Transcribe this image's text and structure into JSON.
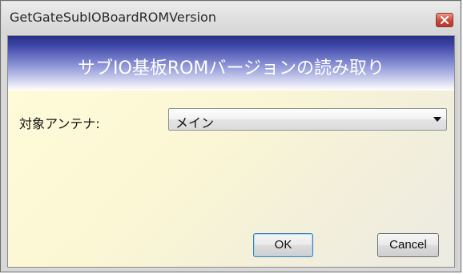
{
  "window": {
    "title": "GetGateSubIOBoardROMVersion",
    "close_icon": "close-icon"
  },
  "banner": {
    "title": "サブIO基板ROMバージョンの読み取り"
  },
  "form": {
    "antenna_label": "対象アンテナ:",
    "antenna_value": "メイン"
  },
  "buttons": {
    "ok": "OK",
    "cancel": "Cancel"
  },
  "colors": {
    "banner_dark": "#2a2f86",
    "close_red": "#c9483a",
    "panel_bg": "#fffbd8"
  }
}
